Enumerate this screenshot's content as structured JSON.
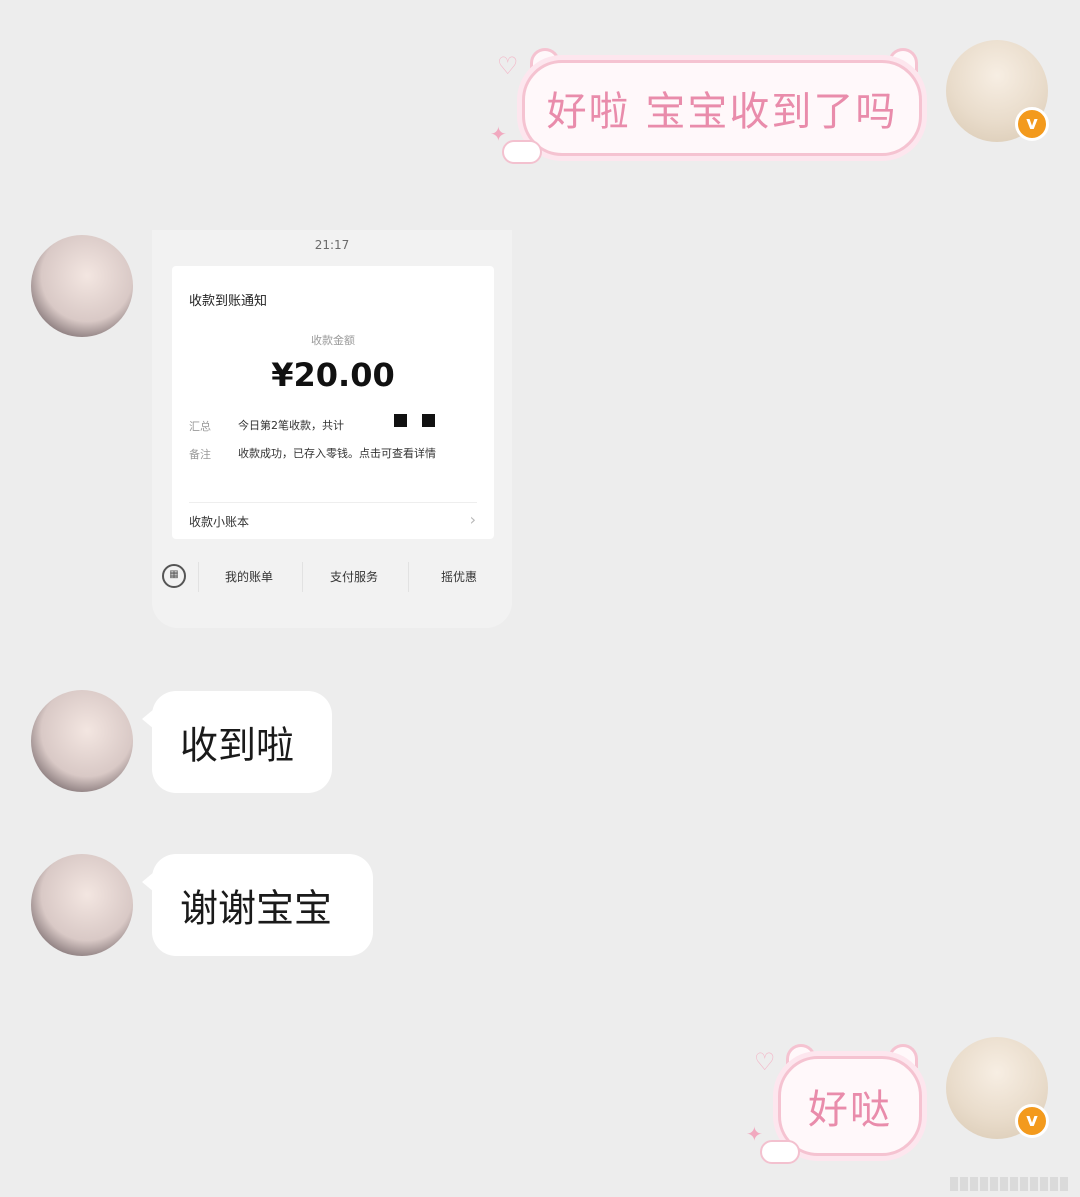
{
  "messages": {
    "out_1": "好啦 宝宝收到了吗",
    "in_text_1": "收到啦",
    "in_text_2": "谢谢宝宝",
    "out_2": "好哒"
  },
  "payment_card": {
    "time": "21:17",
    "title": "收款到账通知",
    "amount_label": "收款金额",
    "amount": "¥20.00",
    "summary_label": "汇总",
    "summary_value": "今日第2笔收款，共计",
    "note_label": "备注",
    "note_value": "收款成功，已存入零钱。点击可查看详情",
    "footer_link": "收款小账本",
    "menu": [
      "我的账单",
      "支付服务",
      "摇优惠"
    ]
  },
  "colors": {
    "background": "#ededed",
    "cute_bubble_border": "#f5c3d1",
    "cute_bubble_text": "#e98cab",
    "vip_badge": "#f39a1d"
  },
  "icons": {
    "vip_badge": "v-badge-icon",
    "chevron": "chevron-right-icon",
    "menu": "keyboard-icon"
  }
}
